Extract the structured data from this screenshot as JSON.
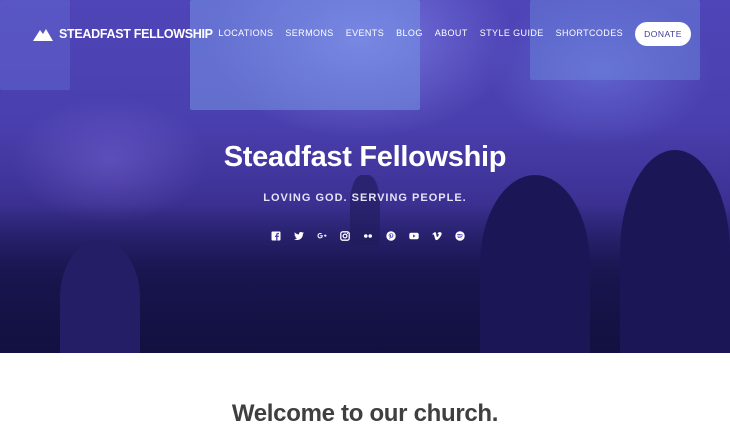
{
  "site": {
    "name": "STEADFAST FELLOWSHIP"
  },
  "nav": {
    "items": [
      {
        "label": "LOCATIONS"
      },
      {
        "label": "SERMONS"
      },
      {
        "label": "EVENTS"
      },
      {
        "label": "BLOG"
      },
      {
        "label": "ABOUT"
      },
      {
        "label": "STYLE GUIDE"
      },
      {
        "label": "SHORTCODES"
      }
    ],
    "donate_label": "DONATE"
  },
  "hero": {
    "title": "Steadfast Fellowship",
    "tagline": "LOVING GOD. SERVING PEOPLE.",
    "social_icons": [
      "facebook-icon",
      "twitter-icon",
      "google-plus-icon",
      "instagram-icon",
      "flickr-icon",
      "pinterest-icon",
      "youtube-icon",
      "vimeo-icon",
      "spotify-icon"
    ]
  },
  "intro": {
    "title": "Welcome to our church."
  },
  "colors": {
    "hero_overlay": "#4a3fae",
    "donate_text": "#3d3a9a",
    "heading_text": "#3f3f3f"
  }
}
